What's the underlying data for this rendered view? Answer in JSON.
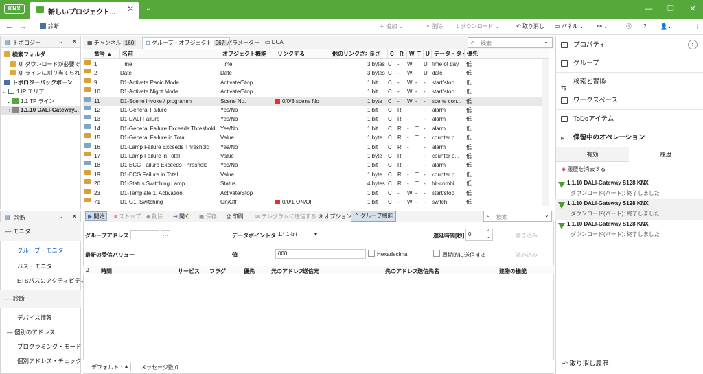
{
  "app": {
    "logo": "KNX",
    "tab_title": "新しいプロジェクト...",
    "accent": "#56a83a"
  },
  "toolbar": {
    "diag_label": "診断",
    "add": "追加",
    "delete": "削除",
    "download": "ダウンロード",
    "undo": "取り消し",
    "panel": "パネル"
  },
  "topology": {
    "title": "トポロジー",
    "items": [
      {
        "label": "検索フォルダ",
        "badge": ""
      },
      {
        "label": "ダウンロードが必要です",
        "badge": "0"
      },
      {
        "label": "ラインに割り当てられま...",
        "badge": "0"
      },
      {
        "label": "トポロジーバックボーン",
        "badge": ""
      },
      {
        "label": "1 IP エリア",
        "badge": ""
      },
      {
        "label": "1.1 TP ライン",
        "badge": ""
      },
      {
        "label": "1.1.10 DALI-Gateway...",
        "badge": ""
      }
    ]
  },
  "tabs": [
    {
      "label": "チャンネル",
      "count": "160"
    },
    {
      "label": "グループ・オブジェクト",
      "count": "967"
    },
    {
      "label": "パラメーター",
      "count": ""
    },
    {
      "label": "DCA",
      "count": ""
    }
  ],
  "search_placeholder": "検索",
  "table": {
    "headers": [
      "番号 ▲",
      "名前",
      "オブジェクト機能",
      "リンクする",
      "他のリンクされた",
      "長さ",
      "C",
      "R",
      "W",
      "T",
      "U",
      "データ・タイプ",
      "優先"
    ],
    "rows": [
      {
        "no": "1",
        "name": "Time",
        "func": "Time",
        "link": "",
        "len": "3 bytes",
        "c": "C",
        "r": "-",
        "w": "W",
        "t": "T",
        "u": "U",
        "dt": "time of day",
        "pr": "低"
      },
      {
        "no": "2",
        "name": "Date",
        "func": "Date",
        "link": "",
        "len": "3 bytes",
        "c": "C",
        "r": "-",
        "w": "W",
        "t": "T",
        "u": "U",
        "dt": "date",
        "pr": "低"
      },
      {
        "no": "9",
        "name": "D1-Activate Panic Mode",
        "func": "Activate/Stop",
        "link": "",
        "len": "1 bit",
        "c": "C",
        "r": "-",
        "w": "W",
        "t": "-",
        "u": "-",
        "dt": "start/stop",
        "pr": "低"
      },
      {
        "no": "10",
        "name": "D1-Activate Night Mode",
        "func": "Activate/Stop",
        "link": "",
        "len": "1 bit",
        "c": "C",
        "r": "-",
        "w": "W",
        "t": "-",
        "u": "-",
        "dt": "start/stop",
        "pr": "低"
      },
      {
        "no": "11",
        "name": "D1-Scene invoke / programm",
        "func": "Scene No.",
        "link": "0/0/3 scene No",
        "len": "1 byte",
        "c": "C",
        "r": "-",
        "w": "W",
        "t": "-",
        "u": "-",
        "dt": "scene con...",
        "pr": "低"
      },
      {
        "no": "12",
        "name": "D1-General Failure",
        "func": "Yes/No",
        "link": "",
        "len": "1 bit",
        "c": "C",
        "r": "R",
        "w": "-",
        "t": "T",
        "u": "-",
        "dt": "alarm",
        "pr": "低"
      },
      {
        "no": "13",
        "name": "D1-DALI Failure",
        "func": "Yes/No",
        "link": "",
        "len": "1 bit",
        "c": "C",
        "r": "R",
        "w": "-",
        "t": "T",
        "u": "-",
        "dt": "alarm",
        "pr": "低"
      },
      {
        "no": "14",
        "name": "D1-General Failure Exceeds Threshold",
        "func": "Yes/No",
        "link": "",
        "len": "1 bit",
        "c": "C",
        "r": "R",
        "w": "-",
        "t": "T",
        "u": "-",
        "dt": "alarm",
        "pr": "低"
      },
      {
        "no": "15",
        "name": "D1-General Failure in Total",
        "func": "Value",
        "link": "",
        "len": "1 byte",
        "c": "C",
        "r": "R",
        "w": "-",
        "t": "T",
        "u": "-",
        "dt": "counter p...",
        "pr": "低"
      },
      {
        "no": "16",
        "name": "D1-Lamp Failure Exceeds Threshold",
        "func": "Yes/No",
        "link": "",
        "len": "1 bit",
        "c": "C",
        "r": "R",
        "w": "-",
        "t": "T",
        "u": "-",
        "dt": "alarm",
        "pr": "低"
      },
      {
        "no": "17",
        "name": "D1-Lamp Failure in Total",
        "func": "Value",
        "link": "",
        "len": "1 byte",
        "c": "C",
        "r": "R",
        "w": "-",
        "t": "T",
        "u": "-",
        "dt": "counter p...",
        "pr": "低"
      },
      {
        "no": "18",
        "name": "D1-ECG Failure Exceeds Threshold",
        "func": "Yes/No",
        "link": "",
        "len": "1 bit",
        "c": "C",
        "r": "R",
        "w": "-",
        "t": "T",
        "u": "-",
        "dt": "alarm",
        "pr": "低"
      },
      {
        "no": "19",
        "name": "D1-ECG Failure in Total",
        "func": "Value",
        "link": "",
        "len": "1 byte",
        "c": "C",
        "r": "R",
        "w": "-",
        "t": "T",
        "u": "-",
        "dt": "counter p...",
        "pr": "低"
      },
      {
        "no": "20",
        "name": "D1-Status Switching Lamp",
        "func": "Status",
        "link": "",
        "len": "4 bytes",
        "c": "C",
        "r": "R",
        "w": "-",
        "t": "T",
        "u": "-",
        "dt": "bit-combi...",
        "pr": "低"
      },
      {
        "no": "23",
        "name": "D1-Template 1, Activation",
        "func": "Activate/Stop",
        "link": "",
        "len": "1 bit",
        "c": "C",
        "r": "-",
        "w": "W",
        "t": "-",
        "u": "-",
        "dt": "start/stop",
        "pr": "低"
      },
      {
        "no": "71",
        "name": "D1-G1, Switching",
        "func": "On/Off",
        "link": "0/0/1 ON/OFF",
        "len": "1 bit",
        "c": "C",
        "r": "-",
        "w": "W",
        "t": "-",
        "u": "-",
        "dt": "switch",
        "pr": "低"
      }
    ]
  },
  "right": {
    "items": [
      "プロパティ",
      "グループ",
      "検索と置換",
      "ワークスペース",
      "ToDoアイテム",
      "保留中のオペレーション"
    ],
    "tabs": [
      "有効",
      "履歴"
    ],
    "clear_history": "履歴を消去する",
    "history": [
      {
        "title": "1.1.10 DALI-Gateway S128 KNX",
        "sub": "ダウンロード(パート): 終了しました"
      },
      {
        "title": "1.1.10 DALI-Gateway S128 KNX",
        "sub": "ダウンロード(パート): 終了しました"
      },
      {
        "title": "1.1.10 DALI-Gateway S128 KNX",
        "sub": "ダウンロード(パート): 終了しました"
      }
    ],
    "undo_history": "取り消し履歴"
  },
  "diag": {
    "title": "診断",
    "sections": [
      {
        "label": "モニター",
        "type": "header"
      },
      {
        "label": "グループ・モニター",
        "type": "active"
      },
      {
        "label": "バス・モニター",
        "type": "item"
      },
      {
        "label": "ETSバスのアクティビティ",
        "type": "item"
      },
      {
        "label": "診断",
        "type": "header"
      },
      {
        "label": "デバイス情報",
        "type": "item"
      },
      {
        "label": "個別のアドレス",
        "type": "subheader"
      },
      {
        "label": "プログラミング・モード",
        "type": "item"
      },
      {
        "label": "個別アドレス・チェック",
        "type": "item"
      }
    ],
    "toolbar": [
      "開始",
      "ストップ",
      "削除",
      "開く",
      "保存",
      "印刷",
      "テレグラムに送信する",
      "オプション",
      "グループ機能"
    ],
    "group_address_label": "グループアドレス",
    "dpt_label": "データポイントタイプ",
    "dpt_value": "1.* 1-bit",
    "delay_label": "遅延時間[秒]",
    "delay_value": "0",
    "write": "書き込み",
    "last_value_label": "最新の受信バリュー",
    "value_label": "値",
    "value_value": "000",
    "hex_label": "Hexadecimal",
    "periodic_label": "周期的に送信する",
    "read": "読み込み",
    "columns": [
      "#",
      "時間",
      "サービス",
      "フラグ",
      "優先",
      "元のアドレス",
      "送信元",
      "先のアドレス",
      "送信先名",
      "建物の機能"
    ],
    "status_default": "デフォルト :",
    "status_messages": "メッセージ数  0"
  }
}
